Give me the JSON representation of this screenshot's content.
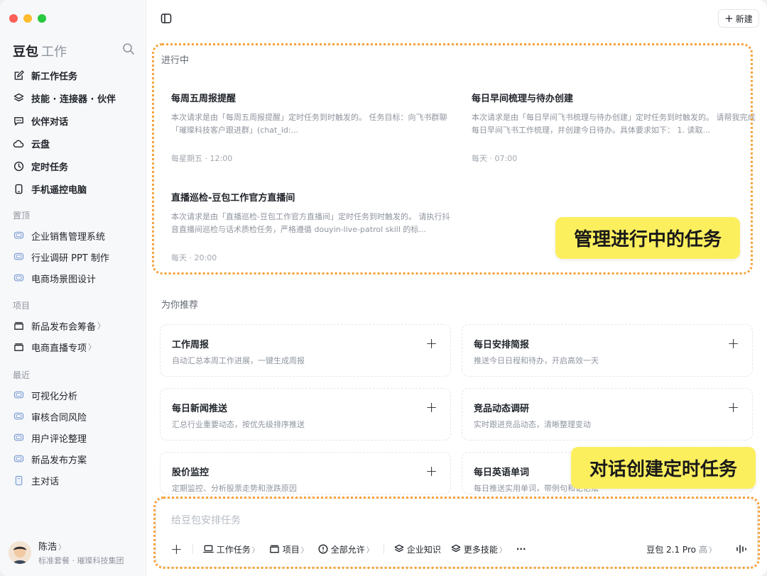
{
  "window": {
    "traffic_colors": [
      "#fe5f57",
      "#febc2e",
      "#28c840"
    ]
  },
  "sidebar": {
    "brand": "豆包",
    "brand_sub": "工作",
    "nav": [
      {
        "label": "新工作任务",
        "icon": "edit-icon"
      },
      {
        "label": "技能 · 连接器 · 伙伴",
        "icon": "layers-icon"
      },
      {
        "label": "伙伴对话",
        "icon": "chat-icon"
      },
      {
        "label": "云盘",
        "icon": "cloud-icon"
      },
      {
        "label": "定时任务",
        "icon": "clock-icon"
      },
      {
        "label": "手机遥控电脑",
        "icon": "phone-icon"
      }
    ],
    "pinned_title": "置顶",
    "pinned": [
      "企业销售管理系统",
      "行业调研 PPT 制作",
      "电商场景图设计"
    ],
    "projects_title": "项目",
    "projects": [
      "新品发布会筹备",
      "电商直播专项"
    ],
    "recent_title": "最近",
    "recent": [
      "可视化分析",
      "审核合同风险",
      "用户评论整理",
      "新品发布方案",
      "主对话"
    ],
    "user": {
      "name": "陈浩",
      "plan": "标准套餐 · 璀璨科技集团"
    }
  },
  "header": {
    "new_label": "新建"
  },
  "in_progress": {
    "title": "进行中",
    "tasks": [
      {
        "title": "每周五周报提醒",
        "desc": "本次请求是由「每周五周报提醒」定时任务到时触发的。 任务目标：向飞书群聊「璀璨科技客户跟进群」(chat_id:...",
        "time": "每星期五 · 12:00"
      },
      {
        "title": "每日早间梳理与待办创建",
        "desc": "本次请求是由「每日早间飞书梳理与待办创建」定时任务到时触发的。 请帮我完成每日早间飞书工作梳理，并创建今日待办。具体要求如下： 1. 读取...",
        "time": "每天 · 07:00"
      },
      {
        "title": "直播巡检-豆包工作官方直播间",
        "desc": "本次请求是由「直播巡检-豆包工作官方直播间」定时任务到时触发的。 请执行抖音直播间巡检与话术质检任务，严格遵循 douyin-live-patrol skill 的标...",
        "time": "每天 · 20:00"
      }
    ],
    "callout": "管理进行中的任务"
  },
  "recommend": {
    "title": "为你推荐",
    "cards": [
      {
        "title": "工作周报",
        "desc": "自动汇总本周工作进展，一键生成周报"
      },
      {
        "title": "每日安排简报",
        "desc": "推送今日日程和待办，开启高效一天"
      },
      {
        "title": "每日新闻推送",
        "desc": "汇总行业重要动态，按优先级排序推送"
      },
      {
        "title": "竞品动态调研",
        "desc": "实时跟进竞品动态，清晰整理变动"
      },
      {
        "title": "股价监控",
        "desc": "定期监控、分析股票走势和涨跌原因"
      },
      {
        "title": "每日英语单词",
        "desc": "每日推送实用单词，带例句和记忆法"
      }
    ],
    "callout": "对话创建定时任务"
  },
  "composer": {
    "placeholder": "给豆包安排任务",
    "tools": [
      {
        "label": "工作任务",
        "icon": "laptop-icon",
        "chevron": "〉"
      },
      {
        "label": "项目",
        "icon": "folder-icon",
        "chevron": "〉"
      },
      {
        "label": "全部允许",
        "icon": "alert-circle-icon",
        "chevron": "〉"
      },
      {
        "label": "企业知识",
        "icon": "layers-icon",
        "chevron": ""
      },
      {
        "label": "更多技能",
        "icon": "layers-icon",
        "chevron": "〉"
      }
    ],
    "more": "···",
    "model": "豆包 2.1 Pro",
    "model_level": "高"
  },
  "accent_colors": {
    "highlight_border": "#f6a23a",
    "callout_bg": "#fcef5e"
  }
}
